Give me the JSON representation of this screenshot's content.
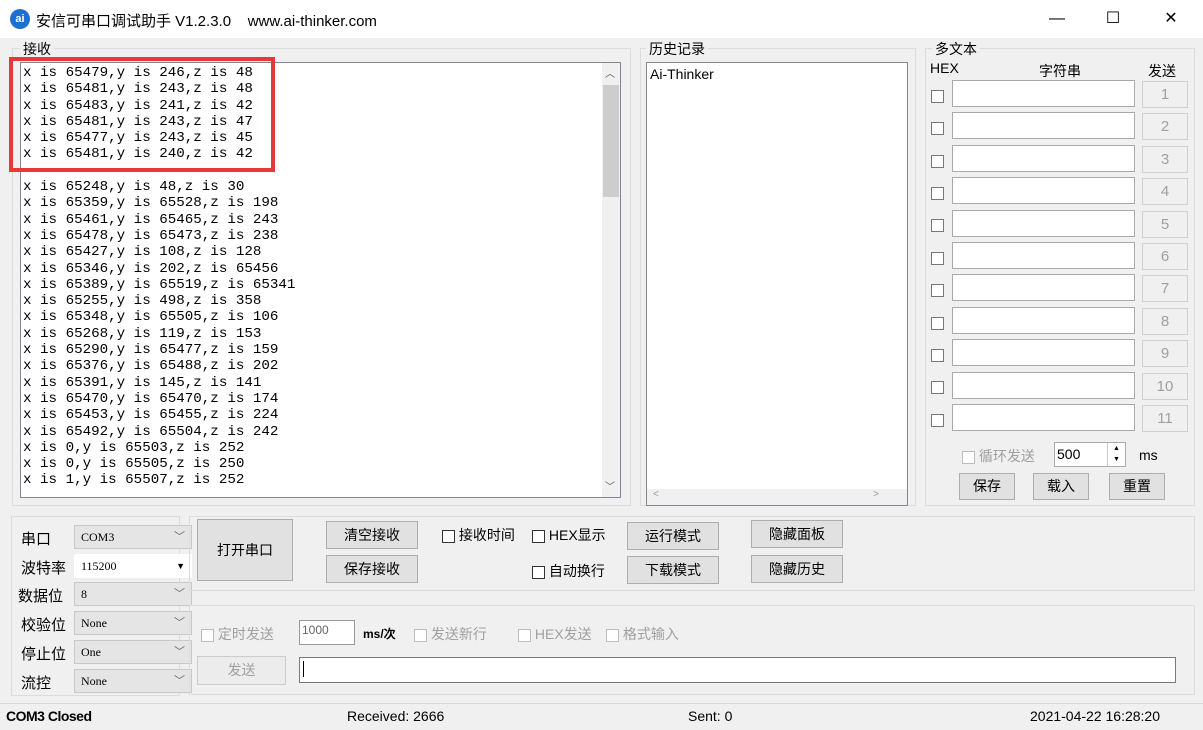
{
  "window": {
    "title": "安信可串口调试助手 V1.2.3.0    www.ai-thinker.com",
    "logo": "ai",
    "minimize": "—",
    "maximize": "☐",
    "close": "✕"
  },
  "receive": {
    "label": "接收",
    "lines": [
      "x is 65479,y is 246,z is 48",
      "x is 65481,y is 243,z is 48",
      "x is 65483,y is 241,z is 42",
      "x is 65481,y is 243,z is 47",
      "x is 65477,y is 243,z is 45",
      "x is 65481,y is 240,z is 42",
      "",
      "x is 65248,y is 48,z is 30",
      "x is 65359,y is 65528,z is 198",
      "x is 65461,y is 65465,z is 243",
      "x is 65478,y is 65473,z is 238",
      "x is 65427,y is 108,z is 128",
      "x is 65346,y is 202,z is 65456",
      "x is 65389,y is 65519,z is 65341",
      "x is 65255,y is 498,z is 358",
      "x is 65348,y is 65505,z is 106",
      "x is 65268,y is 119,z is 153",
      "x is 65290,y is 65477,z is 159",
      "x is 65376,y is 65488,z is 202",
      "x is 65391,y is 145,z is 141",
      "x is 65470,y is 65470,z is 174",
      "x is 65453,y is 65455,z is 224",
      "x is 65492,y is 65504,z is 242",
      "x is 0,y is 65503,z is 252",
      "x is 0,y is 65505,z is 250",
      "x is 1,y is 65507,z is 252"
    ],
    "highlight_color": "#e53935"
  },
  "history": {
    "label": "历史记录",
    "items": [
      "Ai-Thinker"
    ]
  },
  "multi": {
    "label": "多文本",
    "hex": "HEX",
    "string": "字符串",
    "send": "发送",
    "rows": [
      "1",
      "2",
      "3",
      "4",
      "5",
      "6",
      "7",
      "8",
      "9",
      "10",
      "11"
    ],
    "loop_send": "循环发送",
    "interval": "500",
    "ms": "ms",
    "save": "保存",
    "load": "载入",
    "reset": "重置"
  },
  "port": {
    "port_label": "串口",
    "port": "COM3",
    "baud_label": "波特率",
    "baud": "115200",
    "data_label": "数据位",
    "data": "8",
    "parity_label": "校验位",
    "parity": "None",
    "stop_label": "停止位",
    "stop": "One",
    "flow_label": "流控",
    "flow": "None"
  },
  "controls": {
    "open": "打开串口",
    "clear": "清空接收",
    "save": "保存接收",
    "recv_time": "接收时间",
    "hex_display": "HEX显示",
    "auto_wrap": "自动换行",
    "run_mode": "运行模式",
    "download_mode": "下载模式",
    "hide_panel": "隐藏面板",
    "hide_history": "隐藏历史"
  },
  "send": {
    "timed": "定时发送",
    "period": "1000",
    "unit": "ms/次",
    "newline": "发送新行",
    "hex_send": "HEX发送",
    "format": "格式输入",
    "send": "发送",
    "text": ""
  },
  "status": {
    "port": "COM3 Closed",
    "received": "Received: 2666",
    "sent": "Sent: 0",
    "time": "2021-04-22 16:28:20"
  }
}
